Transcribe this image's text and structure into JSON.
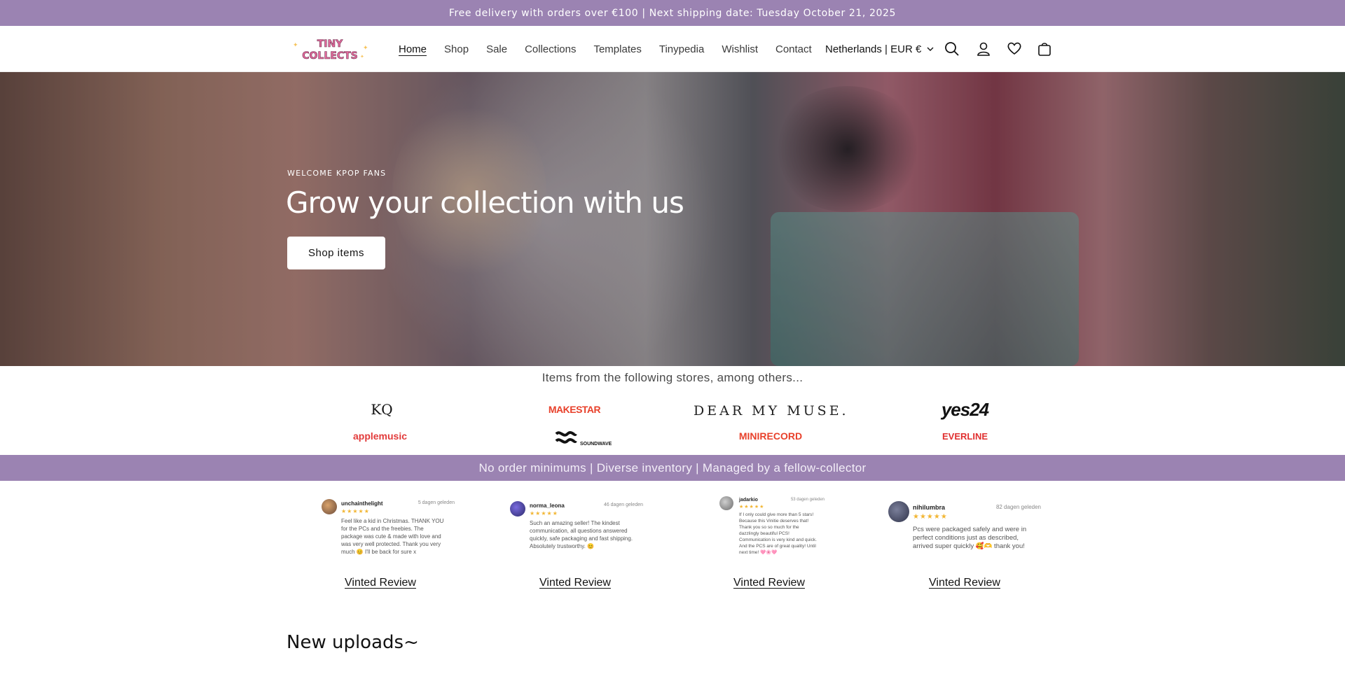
{
  "announcement": "Free delivery with orders over €100 | Next shipping date: Tuesday October 21, 2025",
  "logo_text": [
    "TINY",
    "COLLECTS"
  ],
  "nav": [
    {
      "label": "Home",
      "active": true
    },
    {
      "label": "Shop"
    },
    {
      "label": "Sale"
    },
    {
      "label": "Collections"
    },
    {
      "label": "Templates"
    },
    {
      "label": "Tinypedia"
    },
    {
      "label": "Wishlist"
    },
    {
      "label": "Contact"
    }
  ],
  "locale": "Netherlands | EUR €",
  "header_icons": [
    "search-icon",
    "account-icon",
    "wishlist-heart-icon",
    "cart-icon"
  ],
  "hero": {
    "eyebrow": "WELCOME KPOP FANS",
    "title": "Grow your collection with us",
    "button": "Shop items"
  },
  "stores": {
    "heading": "Items from the following stores, among others...",
    "items": [
      "KQ",
      "MAKESTAR",
      "DEAR MY MUSE.",
      "yes24",
      "applemusic",
      "SOUNDWAVE",
      "MINIRECORD",
      "EVERLINE"
    ]
  },
  "band": "No order minimums | Diverse inventory | Managed by a fellow-collector",
  "reviews": [
    {
      "user": "unchainthelight",
      "ago": "5 dagen geleden",
      "stars": "★★★★★",
      "text": "Feel like a kid in Christmas. THANK YOU for the PCs and the freebies. The package was cute & made with love and was very well protected. Thank you very much 😊 I'll be back for sure x",
      "link": "Vinted Review"
    },
    {
      "user": "norma_leona",
      "ago": "46 dagen geleden",
      "stars": "★★★★★",
      "text": "Such an amazing seller! The kindest communication, all questions answered quickly, safe packaging and fast shipping. Absolutely trustworthy. 😊",
      "link": "Vinted Review"
    },
    {
      "user": "jadarkio",
      "ago": "53 dagen geleden",
      "stars": "★★★★★",
      "text": "If I only could give more than 5 stars! Because this Vinitie deserves that! Thank you so so much for the dazzlingly beautiful PCS! Communication is very kind and quick. And the PCS are of great quality! Until next time! 🩷🌸🩷",
      "link": "Vinted Review"
    },
    {
      "user": "nihilumbra",
      "ago": "82 dagen geleden",
      "stars": "★★★★★",
      "text": "Pcs were packaged safely and were in perfect conditions just as described, arrived super quickly 🥰🫶 thank you!",
      "link": "Vinted Review"
    }
  ],
  "new_uploads_title": "New uploads~",
  "colors": {
    "brand_purple": "#9b83b2",
    "logo_pink": "#e46b9d",
    "star_gold": "#f2b634"
  }
}
